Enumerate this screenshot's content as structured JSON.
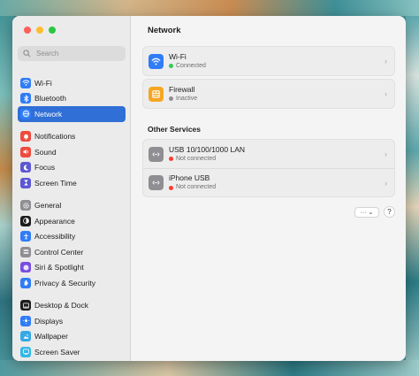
{
  "sidebar": {
    "search_placeholder": "Search",
    "groups": [
      [
        {
          "label": "Wi-Fi",
          "icon": "wifi-icon",
          "color": "#2f7cf6"
        },
        {
          "label": "Bluetooth",
          "icon": "bluetooth-icon",
          "color": "#2f7cf6"
        },
        {
          "label": "Network",
          "icon": "globe-icon",
          "color": "#2f7cf6",
          "active": true
        }
      ],
      [
        {
          "label": "Notifications",
          "icon": "bell-icon",
          "color": "#ef4a3d"
        },
        {
          "label": "Sound",
          "icon": "speaker-icon",
          "color": "#ef4a3d"
        },
        {
          "label": "Focus",
          "icon": "moon-icon",
          "color": "#5d57d3"
        },
        {
          "label": "Screen Time",
          "icon": "hourglass-icon",
          "color": "#5d57d3"
        }
      ],
      [
        {
          "label": "General",
          "icon": "gear-icon",
          "color": "#8e8e93"
        },
        {
          "label": "Appearance",
          "icon": "appearance-icon",
          "color": "#1d1d1f"
        },
        {
          "label": "Accessibility",
          "icon": "accessibility-icon",
          "color": "#2f7cf6"
        },
        {
          "label": "Control Center",
          "icon": "control-center-icon",
          "color": "#8e8e93"
        },
        {
          "label": "Siri & Spotlight",
          "icon": "siri-icon",
          "color": "#7a4de0"
        },
        {
          "label": "Privacy & Security",
          "icon": "hand-icon",
          "color": "#2f7cf6"
        }
      ],
      [
        {
          "label": "Desktop & Dock",
          "icon": "dock-icon",
          "color": "#1d1d1f"
        },
        {
          "label": "Displays",
          "icon": "sun-icon",
          "color": "#2f7cf6"
        },
        {
          "label": "Wallpaper",
          "icon": "wallpaper-icon",
          "color": "#35a8e6"
        },
        {
          "label": "Screen Saver",
          "icon": "screensaver-icon",
          "color": "#35b7e6"
        }
      ]
    ]
  },
  "main": {
    "title": "Network",
    "wifi": {
      "title": "Wi-Fi",
      "status": "Connected",
      "status_color": "#34c759"
    },
    "firewall": {
      "title": "Firewall",
      "status": "Inactive",
      "status_color": "#8e8e93"
    },
    "other_services_title": "Other Services",
    "services": [
      {
        "title": "USB 10/100/1000 LAN",
        "status": "Not connected",
        "status_color": "#ff3b30"
      },
      {
        "title": "iPhone USB",
        "status": "Not connected",
        "status_color": "#ff3b30"
      }
    ],
    "more_label": "··· ⌄",
    "help_label": "?"
  }
}
